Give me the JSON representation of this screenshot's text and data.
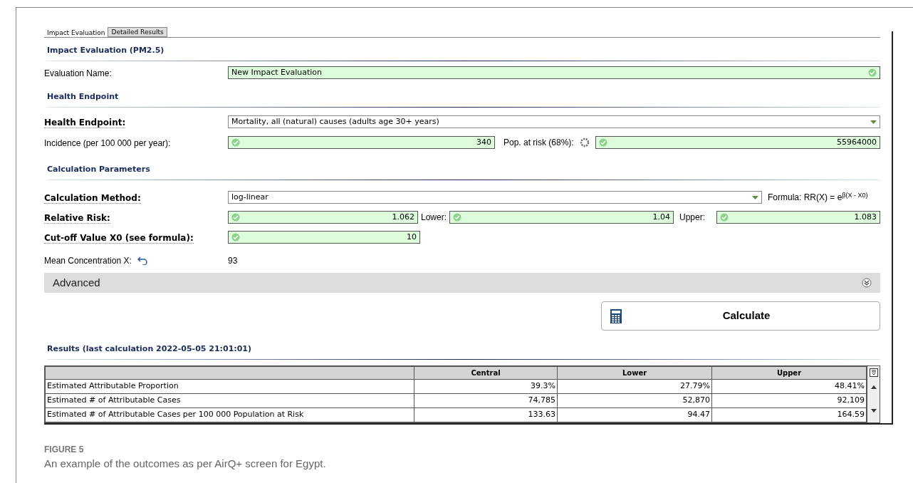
{
  "tabs": [
    {
      "label": "Impact Evaluation",
      "selected": true
    },
    {
      "label": "Detailed Results",
      "selected": false
    }
  ],
  "impact_section": {
    "title": "Impact Evaluation (PM2.5)"
  },
  "evaluation_name": {
    "label": "Evaluation Name:",
    "value": "New Impact Evaluation",
    "valid": true
  },
  "endpoint_section": {
    "title": "Health Endpoint"
  },
  "health_endpoint": {
    "label": "Health Endpoint:",
    "value": "Mortality, all (natural) causes (adults age 30+ years)"
  },
  "incidence": {
    "label": "Incidence (per 100 000 per year):",
    "value": "340",
    "valid": true
  },
  "pop_at_risk": {
    "label": "Pop. at risk (68%):",
    "value": "55964000",
    "valid": true
  },
  "params_section": {
    "title": "Calculation Parameters"
  },
  "calc_method": {
    "label": "Calculation Method:",
    "value": "log-linear",
    "formula": "Formula: RR(X) = e$^{β(X - X0)}$"
  },
  "relative_risk": {
    "label": "Relative Risk:",
    "value": "1.062",
    "valid": true,
    "lower_label": "Lower:",
    "lower": "1.04",
    "lower_valid": true,
    "upper_label": "Upper:",
    "upper": "1.083",
    "upper_valid": true
  },
  "cutoff": {
    "label": "Cut-off Value X0 (see formula):",
    "value": "10",
    "valid": true
  },
  "mean_concentration": {
    "label": "Mean Concentration X:",
    "value": "93"
  },
  "advanced": {
    "label": "Advanced",
    "expanded": false
  },
  "calculate_button": "Calculate",
  "results": {
    "title": "Results (last calculation 2022-05-05 21:01:01)",
    "columns": [
      "Central",
      "Lower",
      "Upper"
    ],
    "rows": [
      {
        "label": "Estimated Attributable Proportion",
        "cells": [
          "39.3%",
          "27.79%",
          "48.41%"
        ]
      },
      {
        "label": "Estimated # of Attributable Cases",
        "cells": [
          "74,785",
          "52,870",
          "92,109"
        ]
      },
      {
        "label": "Estimated # of Attributable Cases per 100 000 Population at Risk",
        "cells": [
          "133.63",
          "94.47",
          "164.59"
        ]
      }
    ]
  },
  "caption": {
    "figure": "FIGURE 5",
    "text": "An example of the outcomes as per AirQ+ screen for Egypt."
  }
}
